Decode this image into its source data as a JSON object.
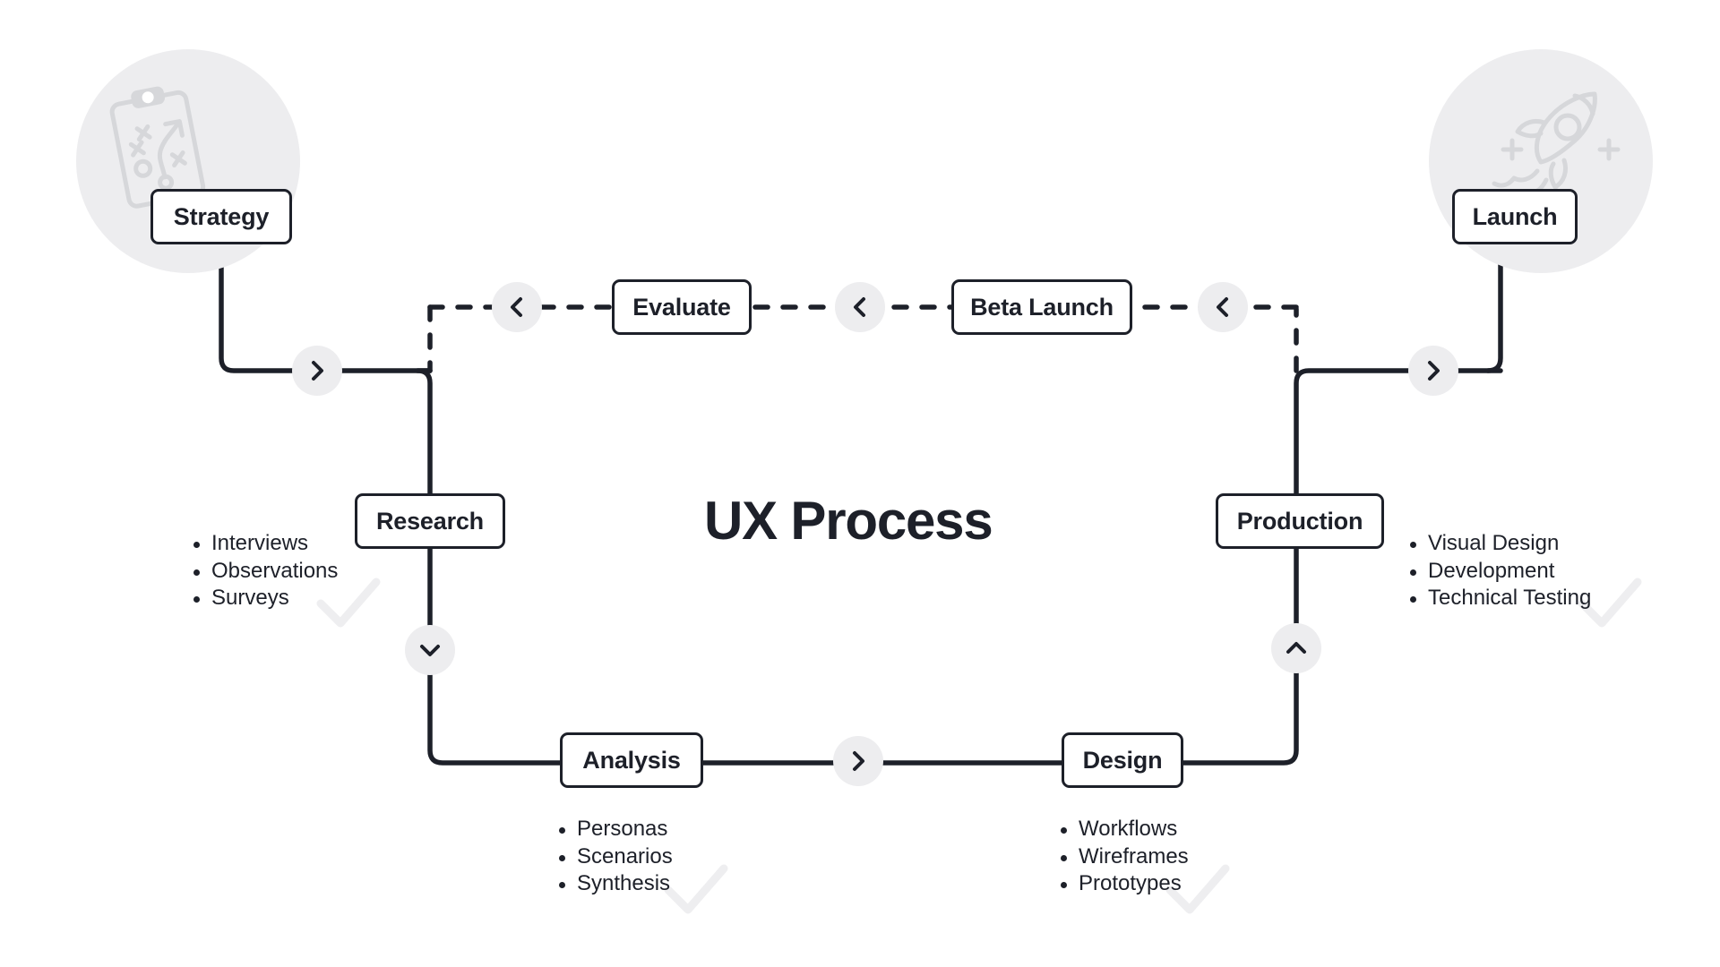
{
  "diagram": {
    "title": "UX Process",
    "colors": {
      "ink": "#1d2029",
      "halo": "#ededef",
      "chevron_bg": "#ededef",
      "watermark": "#eeeef0",
      "icon_stroke": "#d6d7da",
      "page_bg": "#ffffff"
    }
  },
  "endpoints": [
    {
      "id": "strategy",
      "label": "Strategy",
      "icon": "playbook-clipboard-icon"
    },
    {
      "id": "launch",
      "label": "Launch",
      "icon": "rocket-icon"
    }
  ],
  "stages": [
    {
      "id": "research",
      "label": "Research",
      "items": [
        "Interviews",
        "Observations",
        "Surveys"
      ]
    },
    {
      "id": "analysis",
      "label": "Analysis",
      "items": [
        "Personas",
        "Scenarios",
        "Synthesis"
      ]
    },
    {
      "id": "design",
      "label": "Design",
      "items": [
        "Workflows",
        "Wireframes",
        "Prototypes"
      ]
    },
    {
      "id": "production",
      "label": "Production",
      "items": [
        "Visual Design",
        "Development",
        "Technical Testing"
      ]
    }
  ],
  "feedback_stages": [
    {
      "id": "evaluate",
      "label": "Evaluate"
    },
    {
      "id": "beta-launch",
      "label": "Beta Launch"
    }
  ],
  "connectors": [
    {
      "id": "strategy-to-research",
      "direction": "right",
      "style": "solid"
    },
    {
      "id": "research-to-analysis",
      "direction": "down",
      "style": "solid"
    },
    {
      "id": "analysis-to-design",
      "direction": "right",
      "style": "solid"
    },
    {
      "id": "design-to-production",
      "direction": "up",
      "style": "solid"
    },
    {
      "id": "production-to-launch",
      "direction": "right",
      "style": "solid"
    },
    {
      "id": "launch-to-beta",
      "direction": "left",
      "style": "dashed"
    },
    {
      "id": "beta-to-evaluate",
      "direction": "left",
      "style": "dashed"
    },
    {
      "id": "evaluate-to-research",
      "direction": "left",
      "style": "dashed"
    }
  ]
}
